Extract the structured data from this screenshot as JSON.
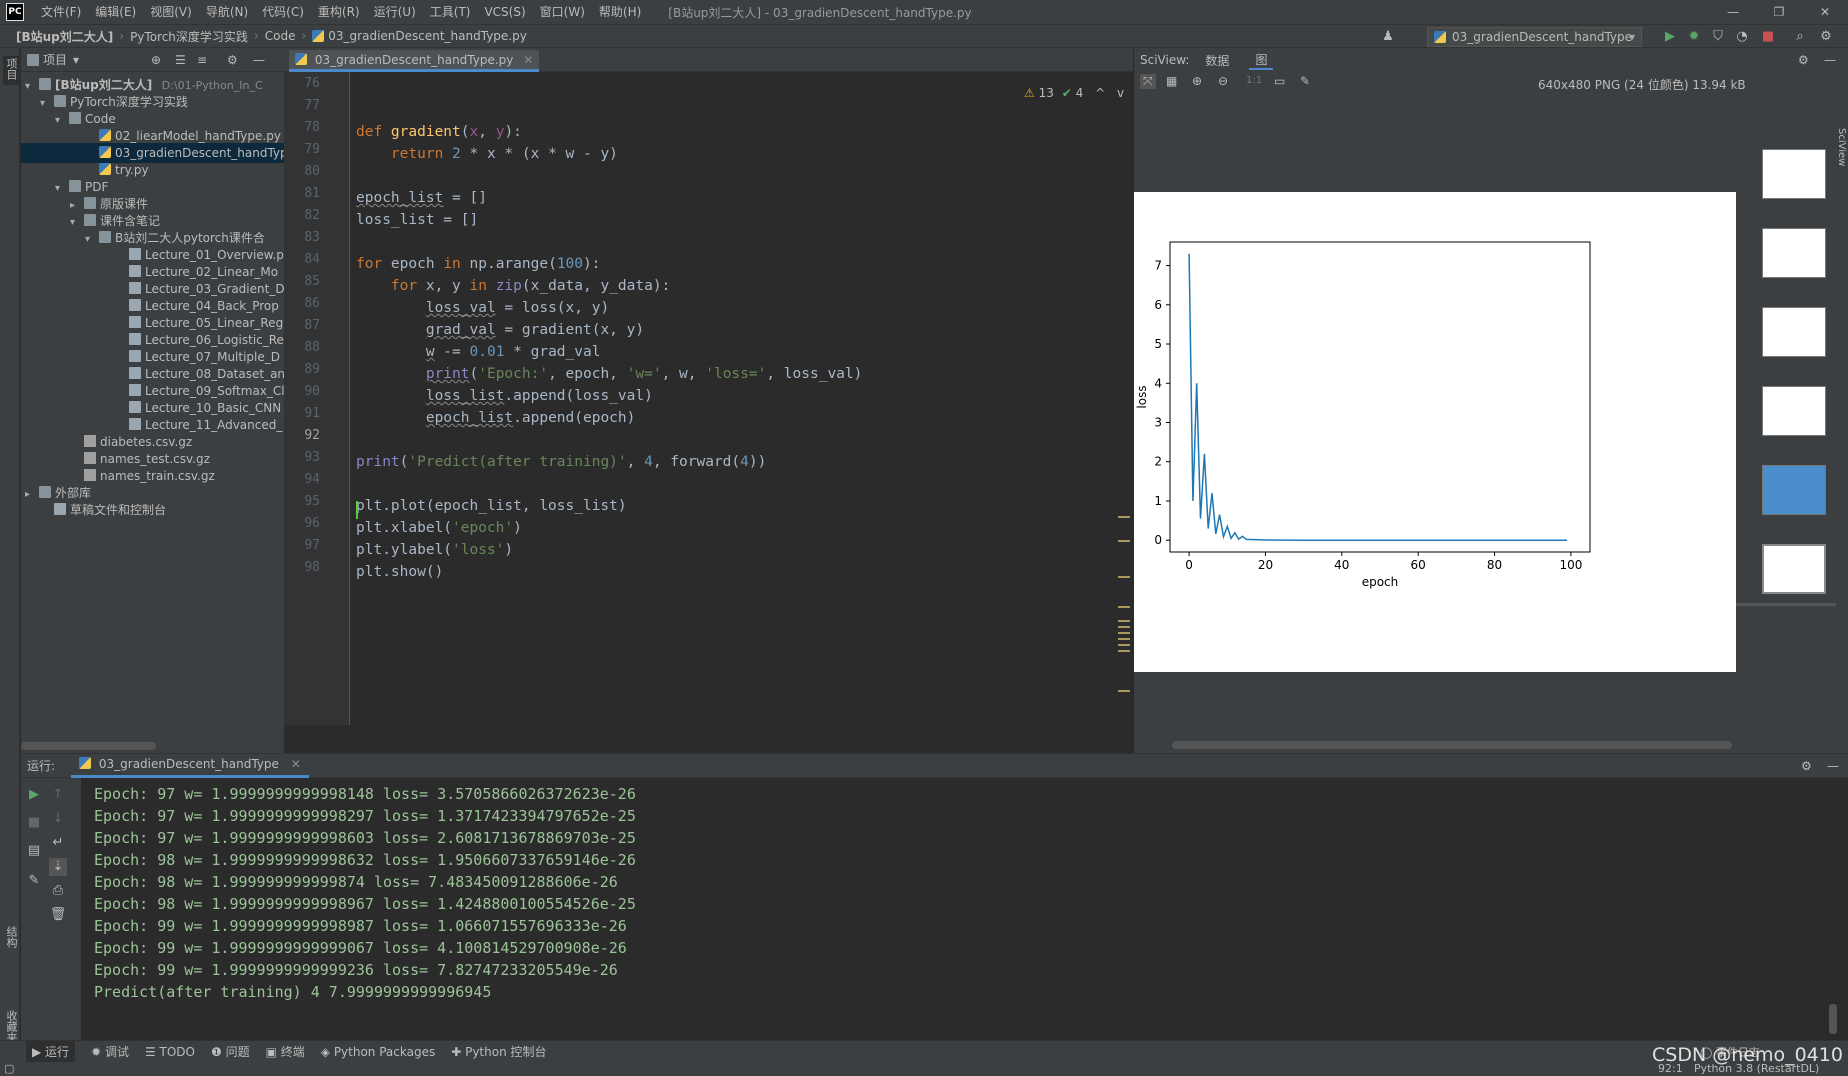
{
  "menubar": {
    "logo": "PC",
    "items": [
      "文件(F)",
      "编辑(E)",
      "视图(V)",
      "导航(N)",
      "代码(C)",
      "重构(R)",
      "运行(U)",
      "工具(T)",
      "VCS(S)",
      "窗口(W)",
      "帮助(H)"
    ],
    "title": "[B站up刘二大人] - 03_gradienDescent_handType.py"
  },
  "navbar": {
    "crumbs": [
      "[B站up刘二大人]",
      "PyTorch深度学习实践",
      "Code",
      "03_gradienDescent_handType.py"
    ],
    "run_config": "03_gradienDescent_handType"
  },
  "left_stripe": {
    "project": "项目",
    "structure": "结构",
    "favorites": "收藏夹"
  },
  "project": {
    "header": "项目",
    "tree": [
      {
        "label": "[B站up刘二大人]",
        "extra": "D:\\01-Python_In_C",
        "icon": "folder",
        "indent": 0,
        "arrow": "▾"
      },
      {
        "label": "PyTorch深度学习实践",
        "icon": "folder",
        "indent": 1,
        "arrow": "▾"
      },
      {
        "label": "Code",
        "icon": "folder",
        "indent": 2,
        "arrow": "▾"
      },
      {
        "label": "02_liearModel_handType.py",
        "icon": "py",
        "indent": 4,
        "arrow": ""
      },
      {
        "label": "03_gradienDescent_handTyp",
        "icon": "py",
        "indent": 4,
        "arrow": "",
        "selected": true
      },
      {
        "label": "try.py",
        "icon": "py",
        "indent": 4,
        "arrow": ""
      },
      {
        "label": "PDF",
        "icon": "folder",
        "indent": 2,
        "arrow": "▾"
      },
      {
        "label": "原版课件",
        "icon": "folder",
        "indent": 3,
        "arrow": "▸"
      },
      {
        "label": "课件含笔记",
        "icon": "folder",
        "indent": 3,
        "arrow": "▾"
      },
      {
        "label": "B站刘二大人pytorch课件合",
        "icon": "folder",
        "indent": 4,
        "arrow": "▾"
      },
      {
        "label": "Lecture_01_Overview.p",
        "icon": "file",
        "indent": 6,
        "arrow": ""
      },
      {
        "label": "Lecture_02_Linear_Mo",
        "icon": "file",
        "indent": 6,
        "arrow": ""
      },
      {
        "label": "Lecture_03_Gradient_D",
        "icon": "file",
        "indent": 6,
        "arrow": ""
      },
      {
        "label": "Lecture_04_Back_Prop",
        "icon": "file",
        "indent": 6,
        "arrow": ""
      },
      {
        "label": "Lecture_05_Linear_Reg",
        "icon": "file",
        "indent": 6,
        "arrow": ""
      },
      {
        "label": "Lecture_06_Logistic_Re",
        "icon": "file",
        "indent": 6,
        "arrow": ""
      },
      {
        "label": "Lecture_07_Multiple_D",
        "icon": "file",
        "indent": 6,
        "arrow": ""
      },
      {
        "label": "Lecture_08_Dataset_an",
        "icon": "file",
        "indent": 6,
        "arrow": ""
      },
      {
        "label": "Lecture_09_Softmax_Cl",
        "icon": "file",
        "indent": 6,
        "arrow": ""
      },
      {
        "label": "Lecture_10_Basic_CNN",
        "icon": "file",
        "indent": 6,
        "arrow": ""
      },
      {
        "label": "Lecture_11_Advanced_",
        "icon": "file",
        "indent": 6,
        "arrow": ""
      },
      {
        "label": "diabetes.csv.gz",
        "icon": "gz",
        "indent": 3,
        "arrow": ""
      },
      {
        "label": "names_test.csv.gz",
        "icon": "gz",
        "indent": 3,
        "arrow": ""
      },
      {
        "label": "names_train.csv.gz",
        "icon": "gz",
        "indent": 3,
        "arrow": ""
      },
      {
        "label": "外部库",
        "icon": "lib",
        "indent": 0,
        "arrow": "▸"
      },
      {
        "label": "草稿文件和控制台",
        "icon": "scratch",
        "indent": 1,
        "arrow": ""
      }
    ]
  },
  "editor": {
    "tab": "03_gradienDescent_handType.py",
    "inspections": {
      "warnings": "13",
      "ok": "4"
    },
    "line_numbers": [
      "76",
      "77",
      "78",
      "79",
      "80",
      "81",
      "82",
      "83",
      "84",
      "85",
      "86",
      "87",
      "88",
      "89",
      "90",
      "91",
      "92",
      "93",
      "94",
      "95",
      "96",
      "97",
      "98"
    ],
    "current_line": "92"
  },
  "sciview": {
    "label": "SciView:",
    "tabs": [
      "数据",
      "图"
    ],
    "image_info": "640x480 PNG (24 位颜色) 13.94 kB",
    "side_label": "SciView"
  },
  "chart_data": {
    "type": "line",
    "xlabel": "epoch",
    "ylabel": "loss",
    "xlim": [
      -5,
      105
    ],
    "ylim": [
      -0.3,
      7.6
    ],
    "xticks": [
      "0",
      "20",
      "40",
      "60",
      "80",
      "100"
    ],
    "yticks": [
      "0",
      "1",
      "2",
      "3",
      "4",
      "5",
      "6",
      "7"
    ],
    "color": "#1f77b4",
    "series": [
      {
        "x": [
          0,
          1,
          2,
          3,
          4,
          5,
          6,
          7,
          8,
          9,
          10,
          11,
          12,
          13,
          14,
          15,
          20,
          30,
          40,
          50,
          60,
          70,
          80,
          90,
          99
        ],
        "values": [
          7.3,
          1.0,
          4.0,
          0.55,
          2.2,
          0.3,
          1.2,
          0.16,
          0.65,
          0.09,
          0.35,
          0.05,
          0.19,
          0.03,
          0.1,
          0.02,
          0.005,
          0.0,
          0.0,
          0.0,
          0.0,
          0.0,
          0.0,
          0.0,
          0.0
        ]
      }
    ]
  },
  "run": {
    "label": "运行:",
    "tab": "03_gradienDescent_handType",
    "lines": [
      "Epoch: 97 w= 1.9999999999998148 loss= 3.5705866026372623e-26",
      "Epoch: 97 w= 1.9999999999998297 loss= 1.3717423394797652e-25",
      "Epoch: 97 w= 1.9999999999998603 loss= 2.6081713678869703e-25",
      "Epoch: 98 w= 1.9999999999998632 loss= 1.9506607337659146e-26",
      "Epoch: 98 w= 1.999999999999874 loss= 7.483450091288606e-26",
      "Epoch: 98 w= 1.9999999999998967 loss= 1.4248800100554526e-25",
      "Epoch: 99 w= 1.9999999999998987 loss= 1.066071557696333e-26",
      "Epoch: 99 w= 1.9999999999999067 loss= 4.100814529700908e-26",
      "Epoch: 99 w= 1.9999999999999236 loss= 7.82747233205549e-26",
      "Predict(after training) 4 7.9999999999996945"
    ]
  },
  "bottom_bar": {
    "items": [
      "运行",
      "调试",
      "TODO",
      "问题",
      "终端",
      "Python Packages",
      "Python 控制台"
    ],
    "event_log": "事件日志"
  },
  "status_bar": {
    "position": "92:1",
    "interpreter": "Python 3.8 (RestartDL)"
  },
  "watermark": "CSDN @nemo_0410"
}
